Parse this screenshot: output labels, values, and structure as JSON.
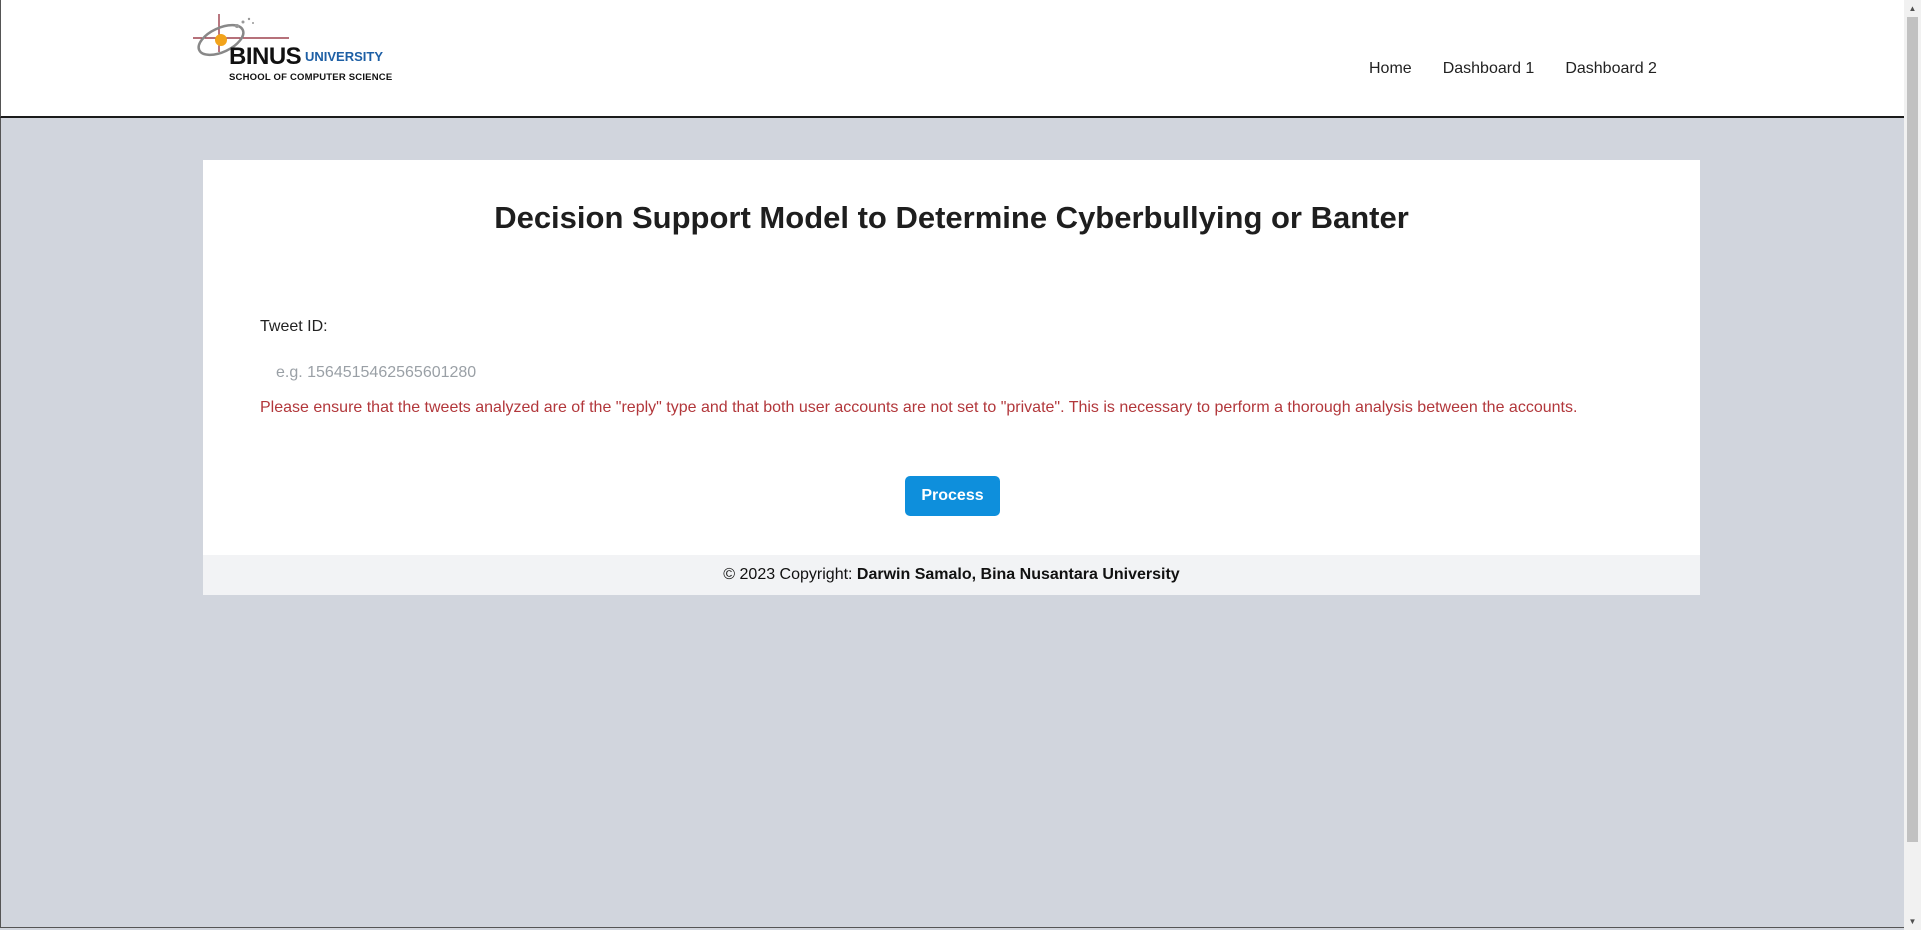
{
  "header": {
    "logo": {
      "brand": "BINUS",
      "brand_sub": "UNIVERSITY",
      "school": "SCHOOL OF COMPUTER SCIENCE",
      "emblem_icon": "binus-emblem-icon"
    },
    "nav": [
      {
        "label": "Home"
      },
      {
        "label": "Dashboard 1"
      },
      {
        "label": "Dashboard 2"
      }
    ]
  },
  "main": {
    "title": "Decision Support Model to Determine Cyberbullying or Banter",
    "tweet_label": "Tweet ID:",
    "tweet_input": {
      "value": "",
      "placeholder": "e.g. 1564515462565601280"
    },
    "warning": "Please ensure that the tweets analyzed are of the \"reply\" type and that both user accounts are not set to \"private\". This is necessary to perform a thorough analysis between the accounts.",
    "process_label": "Process"
  },
  "footer": {
    "copyright": "© 2023 Copyright: ",
    "owner": "Darwin Samalo, Bina Nusantara University"
  },
  "colors": {
    "page_background": "#d1d5dd",
    "accent_button": "#0e8fdc",
    "warning_text": "#b2373b",
    "brand_blue": "#1d5fa5",
    "footer_background": "#f2f3f5"
  }
}
